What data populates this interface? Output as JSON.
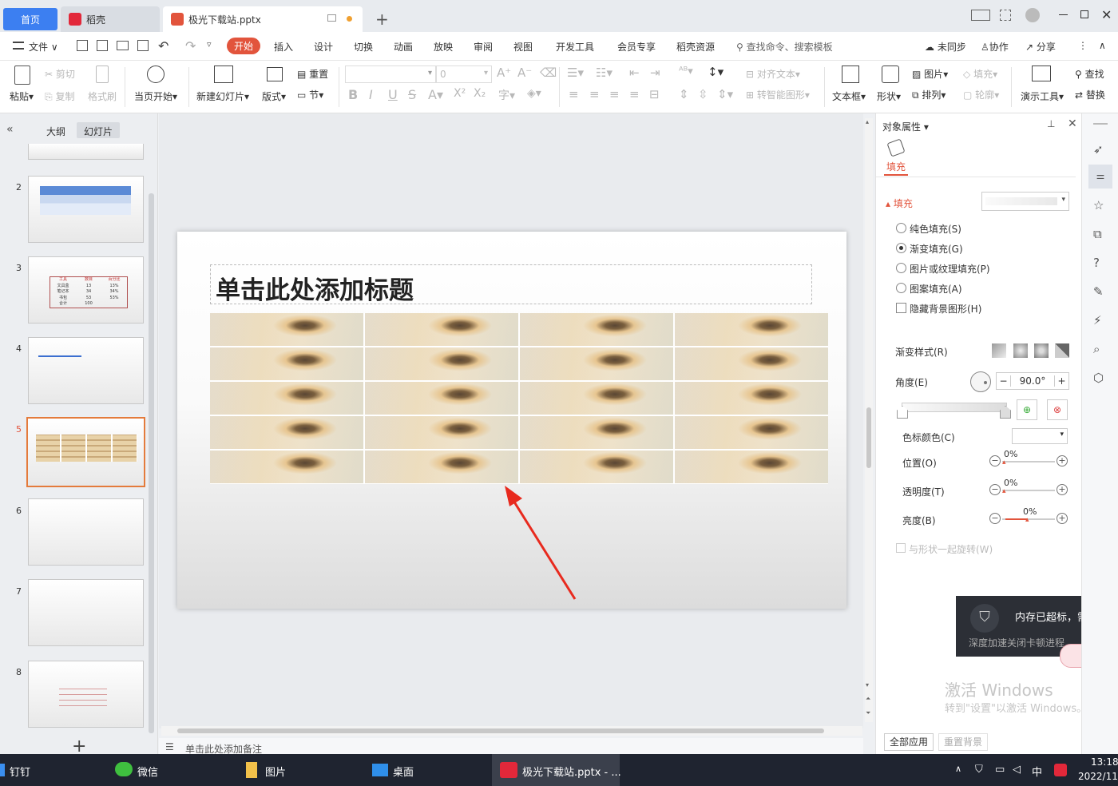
{
  "tabs": {
    "home": "首页",
    "daoke": "稻壳",
    "file": "极光下载站.pptx"
  },
  "window": {
    "add_tab": "+"
  },
  "menu": {
    "file": "文件",
    "items": [
      "开始",
      "插入",
      "设计",
      "切换",
      "动画",
      "放映",
      "审阅",
      "视图",
      "开发工具",
      "会员专享",
      "稻壳资源"
    ],
    "search": "查找命令、搜索模板",
    "sync": "未同步",
    "collab": "协作",
    "share": "分享"
  },
  "ribbon": {
    "paste": "粘贴",
    "cut": "剪切",
    "copy": "复制",
    "format_painter": "格式刷",
    "from_current": "当页开始",
    "new_slide": "新建幻灯片",
    "layout": "版式",
    "reset": "重置",
    "section": "节",
    "font_size": "0",
    "align_text": "对齐文本",
    "smart_shape": "转智能图形",
    "textbox": "文本框",
    "shape": "形状",
    "picture": "图片",
    "arrange": "排列",
    "fill": "填充",
    "outline": "轮廓",
    "present_tools": "演示工具",
    "find": "查找",
    "replace": "替换"
  },
  "left_panel": {
    "tab_outline": "大纲",
    "tab_slides": "幻灯片",
    "slide_numbers": [
      "2",
      "3",
      "4",
      "5",
      "6",
      "7",
      "8"
    ],
    "selected": "5",
    "add": "+",
    "slide3_table": [
      [
        "工具",
        "数目",
        "百分比"
      ],
      [
        "文具盒",
        "13",
        "13%"
      ],
      [
        "笔记本",
        "34",
        "34%"
      ],
      [
        "书包",
        "53",
        "53%"
      ],
      [
        "合计",
        "100",
        ""
      ]
    ]
  },
  "slide": {
    "title_placeholder": "单击此处添加标题"
  },
  "notes": {
    "placeholder": "单击此处添加备注"
  },
  "right_panel": {
    "header": "对象属性",
    "fill_tab": "填充",
    "fill_section": "填充",
    "options": [
      "纯色填充(S)",
      "渐变填充(G)",
      "图片或纹理填充(P)",
      "图案填充(A)"
    ],
    "selected_option": "渐变填充(G)",
    "hide_bg": "隐藏背景图形(H)",
    "gradient_style": "渐变样式(R)",
    "angle_label": "角度(E)",
    "angle_value": "90.0°",
    "stop_color": "色标颜色(C)",
    "position_label": "位置(O)",
    "position_value": "0%",
    "transparency_label": "透明度(T)",
    "transparency_value": "0%",
    "brightness_label": "亮度(B)",
    "brightness_value": "0%",
    "rotate_with_shape": "与形状一起旋转(W)",
    "apply_all": "全部应用",
    "reset_bg": "重置背景"
  },
  "notification": {
    "title": "内存已超标，需要",
    "title_tail": "深",
    "subtitle": "深度加速关闭卡顿进程"
  },
  "watermark": {
    "line1": "激活 Windows",
    "line2": "转到\"设置\"以激活 Windows。"
  },
  "taskbar": {
    "items": [
      "钉钉",
      "微信",
      "图片",
      "桌面",
      "极光下载站.pptx - ..."
    ],
    "ime": "中",
    "time": "13:18",
    "date": "2022/11/"
  },
  "colors": {
    "accent": "#e2543c",
    "home_tab": "#3c7ff1",
    "taskbar": "#1f2430"
  }
}
